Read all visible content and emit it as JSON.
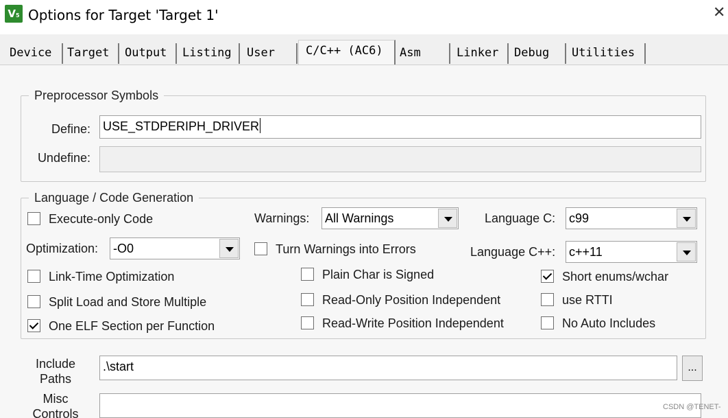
{
  "window": {
    "title": "Options for Target 'Target 1'",
    "close_glyph": "✕",
    "icon": "keil-uvision-icon"
  },
  "tabs": [
    {
      "label": "Device"
    },
    {
      "label": "Target"
    },
    {
      "label": "Output"
    },
    {
      "label": "Listing"
    },
    {
      "label": "User"
    },
    {
      "label": "C/C++ (AC6)",
      "active": true
    },
    {
      "label": "Asm"
    },
    {
      "label": "Linker"
    },
    {
      "label": "Debug"
    },
    {
      "label": "Utilities"
    }
  ],
  "preprocessor": {
    "group_label": "Preprocessor Symbols",
    "define_label": "Define:",
    "define_value": "USE_STDPERIPH_DRIVER",
    "undefine_label": "Undefine:",
    "undefine_value": ""
  },
  "codegen": {
    "group_label": "Language / Code Generation",
    "execute_only": {
      "label": "Execute-only Code",
      "checked": false
    },
    "warnings_label": "Warnings:",
    "warnings_value": "All Warnings",
    "language_c_label": "Language C:",
    "language_c_value": "c99",
    "optimization_label": "Optimization:",
    "optimization_value": "-O0",
    "turn_warnings": {
      "label": "Turn Warnings into Errors",
      "checked": false
    },
    "language_cpp_label": "Language C++:",
    "language_cpp_value": "c++11",
    "lto": {
      "label": "Link-Time Optimization",
      "checked": false
    },
    "plain_char": {
      "label": "Plain Char is Signed",
      "checked": false
    },
    "short_enums": {
      "label": "Short enums/wchar",
      "checked": true
    },
    "split_load": {
      "label": "Split Load and Store Multiple",
      "checked": false
    },
    "ropi": {
      "label": "Read-Only Position Independent",
      "checked": false
    },
    "use_rtti": {
      "label": "use RTTI",
      "checked": false
    },
    "one_elf": {
      "label": "One ELF Section per Function",
      "checked": true
    },
    "rwpi": {
      "label": "Read-Write Position Independent",
      "checked": false
    },
    "no_auto_includes": {
      "label": "No Auto Includes",
      "checked": false
    }
  },
  "include": {
    "label_line1": "Include",
    "label_line2": "Paths",
    "value": ".\\start",
    "browse_label": "..."
  },
  "misc": {
    "label_line1": "Misc",
    "label_line2": "Controls",
    "value": ""
  },
  "watermark": "CSDN @TENET-"
}
